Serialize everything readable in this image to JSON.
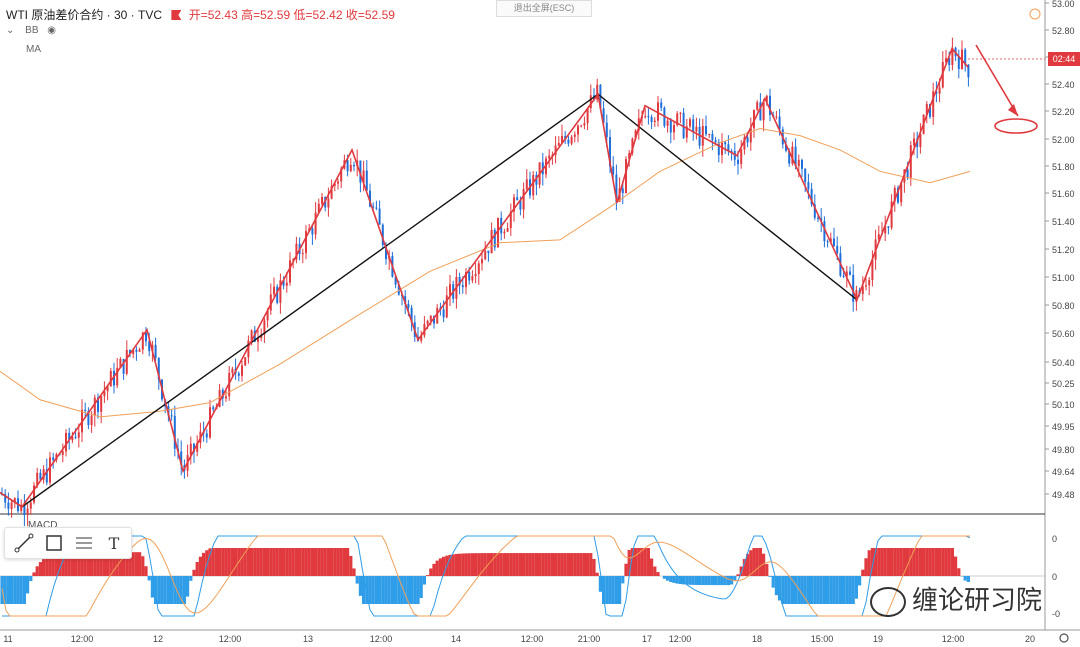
{
  "header": {
    "symbol": "WTI 原油差价合约 · 30 · TVC",
    "open_label": "开=52.43",
    "high_label": "高=52.59",
    "low_label": "低=52.42",
    "close_label": "收=52.59",
    "bb_label": "BB",
    "ma_label": "MA"
  },
  "esc_button": "退出全屏(ESC)",
  "indicator_label": "MACD",
  "watermark": "缠论研习院",
  "price_tag": "02:44",
  "colors": {
    "up": "#e0393e",
    "down": "#1e6fd9",
    "ma": "#f0a057",
    "zigzag": "#e0393e",
    "trend": "#111111"
  },
  "chart_data": [
    {
      "type": "line",
      "y_axis_ticks": [
        "53.00",
        "52.80",
        "52.60",
        "52.40",
        "52.20",
        "52.00",
        "51.80",
        "51.60",
        "51.40",
        "51.20",
        "51.00",
        "50.80",
        "50.60",
        "50.40",
        "50.25",
        "50.10",
        "49.95",
        "49.80",
        "49.64",
        "49.48"
      ],
      "x_axis_ticks": [
        "11",
        "12:00",
        "12",
        "12:00",
        "13",
        "12:00",
        "14",
        "12:00",
        "21:00",
        "17",
        "12:00",
        "18",
        "15:00",
        "19",
        "12:00",
        "20"
      ],
      "ylim": [
        49.4,
        53.0
      ],
      "series": [
        {
          "role": "zigzag",
          "points": [
            [
              0,
              49.55
            ],
            [
              22,
              49.45
            ],
            [
              147,
              50.69
            ],
            [
              183,
              49.7
            ],
            [
              352,
              51.95
            ],
            [
              418,
              50.62
            ],
            [
              598,
              52.34
            ],
            [
              617,
              51.58
            ],
            [
              645,
              52.26
            ],
            [
              737,
              51.91
            ],
            [
              765,
              52.31
            ],
            [
              857,
              50.9
            ],
            [
              952,
              52.66
            ],
            [
              968,
              52.53
            ]
          ]
        },
        {
          "role": "trend",
          "points": [
            [
              0,
              49.55
            ],
            [
              22,
              49.45
            ],
            [
              598,
              52.34
            ],
            [
              857,
              50.9
            ]
          ]
        },
        {
          "role": "ma",
          "points": [
            [
              0,
              50.4
            ],
            [
              40,
              50.2
            ],
            [
              100,
              50.08
            ],
            [
              160,
              50.12
            ],
            [
              210,
              50.18
            ],
            [
              280,
              50.45
            ],
            [
              360,
              50.8
            ],
            [
              430,
              51.1
            ],
            [
              500,
              51.3
            ],
            [
              560,
              51.32
            ],
            [
              610,
              51.55
            ],
            [
              660,
              51.8
            ],
            [
              720,
              52.0
            ],
            [
              760,
              52.1
            ],
            [
              800,
              52.05
            ],
            [
              840,
              51.95
            ],
            [
              880,
              51.8
            ],
            [
              930,
              51.72
            ],
            [
              970,
              51.8
            ]
          ]
        }
      ]
    },
    {
      "type": "area",
      "title": "MACD",
      "y_axis_ticks": [
        "0",
        "0",
        "-0"
      ]
    }
  ]
}
